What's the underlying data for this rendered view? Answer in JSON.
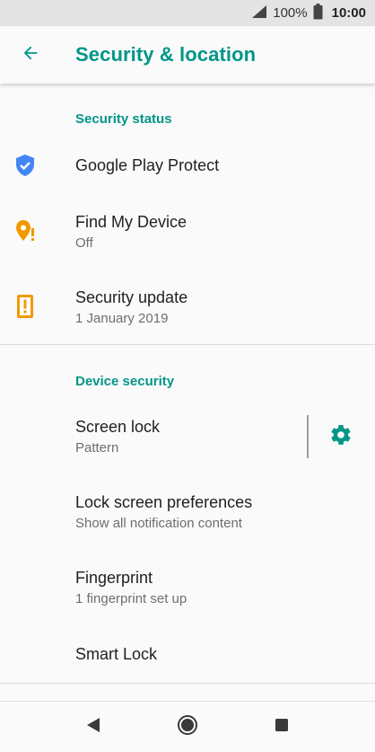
{
  "status_bar": {
    "battery_percent": "100%",
    "time": "10:00",
    "icons": [
      "signal-icon",
      "battery-icon"
    ]
  },
  "app_bar": {
    "title": "Security & location",
    "back_icon": "arrow-back-icon"
  },
  "sections": [
    {
      "header": "Security status",
      "items": [
        {
          "title": "Google Play Protect",
          "icon": "shield-check-icon"
        },
        {
          "title": "Find My Device",
          "subtitle": "Off",
          "icon": "location-alert-icon"
        },
        {
          "title": "Security update",
          "subtitle": "1 January 2019",
          "icon": "phone-alert-icon"
        }
      ]
    },
    {
      "header": "Device security",
      "items": [
        {
          "title": "Screen lock",
          "subtitle": "Pattern",
          "action_icon": "gear-icon"
        },
        {
          "title": "Lock screen preferences",
          "subtitle": "Show all notification content"
        },
        {
          "title": "Fingerprint",
          "subtitle": "1 fingerprint set up"
        },
        {
          "title": "Smart Lock"
        }
      ]
    }
  ],
  "nav_bar": {
    "icons": [
      "back-triangle-icon",
      "home-circle-icon",
      "recents-square-icon"
    ]
  },
  "colors": {
    "accent": "#009688",
    "shield_blue": "#4285f4",
    "alert_orange": "#f29900",
    "status_bar_bg": "#e4e4e4",
    "page_bg": "#fafafa"
  }
}
